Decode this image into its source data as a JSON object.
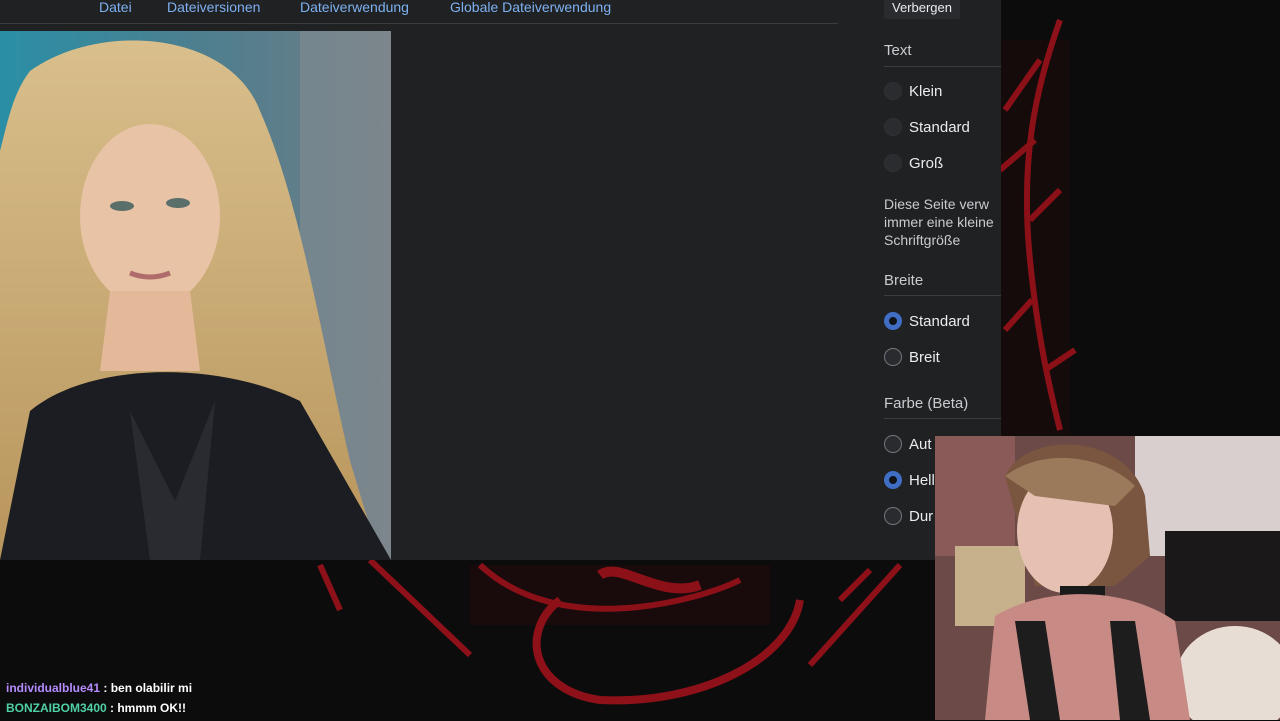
{
  "wiki": {
    "tabs": [
      "Datei",
      "Dateiversionen",
      "Dateiverwendung",
      "Globale Dateiverwendung"
    ]
  },
  "sidebar": {
    "hide_label": "Verbergen",
    "text": {
      "title": "Text",
      "options": [
        {
          "label": "Klein",
          "checked": false
        },
        {
          "label": "Standard",
          "checked": false
        },
        {
          "label": "Groß",
          "checked": false
        }
      ],
      "note": "Diese Seite verw immer eine kleine Schriftgröße"
    },
    "width": {
      "title": "Breite",
      "options": [
        {
          "label": "Standard",
          "checked": true
        },
        {
          "label": "Breit",
          "checked": false
        }
      ]
    },
    "color": {
      "title": "Farbe (Beta)",
      "options": [
        {
          "label": "Aut",
          "checked": false
        },
        {
          "label": "Hell",
          "checked": true
        },
        {
          "label": "Dur",
          "checked": false
        }
      ]
    }
  },
  "chat": {
    "messages": [
      {
        "user": "individualblue41",
        "text": " : ben olabilir mi",
        "color": "#b58cff"
      },
      {
        "user": "BONZAIBOM3400",
        "text": " : hmmm OK!!",
        "color": "#4fd1a5"
      }
    ]
  },
  "colors": {
    "accent": "#3f6ec4",
    "link": "#7eb1f1",
    "art_red": "#a3121c"
  }
}
